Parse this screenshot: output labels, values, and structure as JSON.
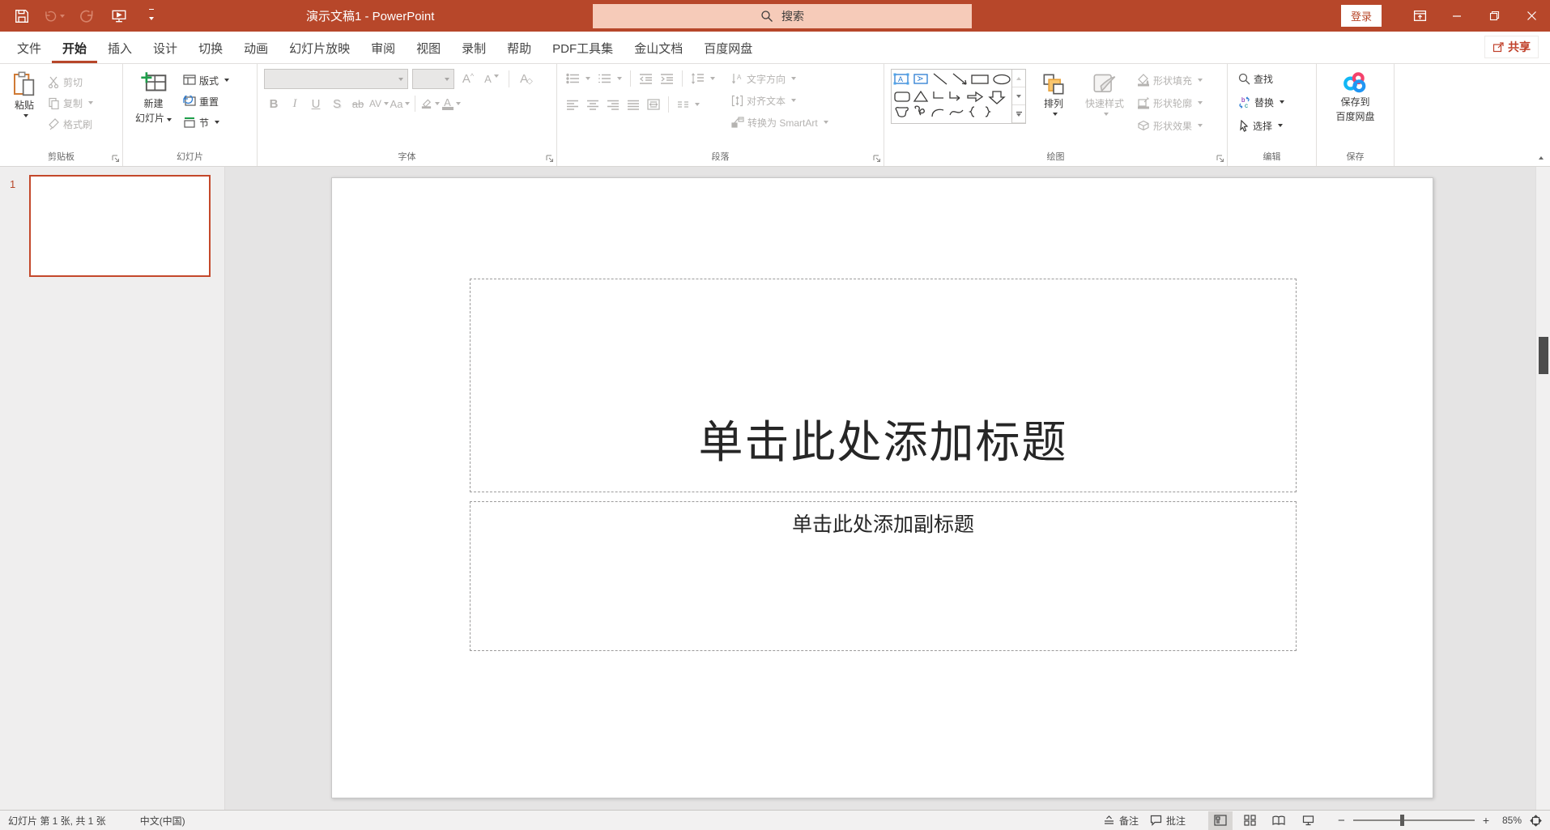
{
  "titlebar": {
    "title": "演示文稿1  -  PowerPoint",
    "search_placeholder": "搜索",
    "login": "登录"
  },
  "tabs": [
    "文件",
    "开始",
    "插入",
    "设计",
    "切换",
    "动画",
    "幻灯片放映",
    "审阅",
    "视图",
    "录制",
    "帮助",
    "PDF工具集",
    "金山文档",
    "百度网盘"
  ],
  "share": "共享",
  "ribbon": {
    "clipboard": {
      "label": "剪贴板",
      "paste": "粘贴",
      "cut": "剪切",
      "copy": "复制",
      "format_painter": "格式刷"
    },
    "slides": {
      "label": "幻灯片",
      "new_slide_line1": "新建",
      "new_slide_line2": "幻灯片",
      "layout": "版式",
      "reset": "重置",
      "section": "节"
    },
    "font": {
      "label": "字体",
      "bold": "B",
      "italic": "I",
      "underline": "U",
      "shadow": "S",
      "strike": "ab",
      "spacing": "AV",
      "case": "Aa",
      "grow": "A",
      "shrink": "A",
      "clear": "A"
    },
    "paragraph": {
      "label": "段落",
      "text_direction": "文字方向",
      "align_text": "对齐文本",
      "smartart": "转换为 SmartArt"
    },
    "drawing": {
      "label": "绘图",
      "arrange": "排列",
      "quick_styles": "快速样式",
      "shape_fill": "形状填充",
      "shape_outline": "形状轮廓",
      "shape_effects": "形状效果"
    },
    "editing": {
      "label": "编辑",
      "find": "查找",
      "replace": "替换",
      "select": "选择"
    },
    "save": {
      "label": "保存",
      "line1": "保存到",
      "line2": "百度网盘"
    }
  },
  "slides_panel": {
    "number": "1"
  },
  "slide": {
    "title_placeholder": "单击此处添加标题",
    "subtitle_placeholder": "单击此处添加副标题"
  },
  "statusbar": {
    "slide_info": "幻灯片 第 1 张, 共 1 张",
    "language": "中文(中国)",
    "notes": "备注",
    "comments": "批注",
    "zoom_level": "85%"
  },
  "colors": {
    "titlebar": "#B7472A",
    "accent": "#B7472A",
    "search_bg": "#F6CBB9",
    "disabled": "#B5B3B1"
  }
}
